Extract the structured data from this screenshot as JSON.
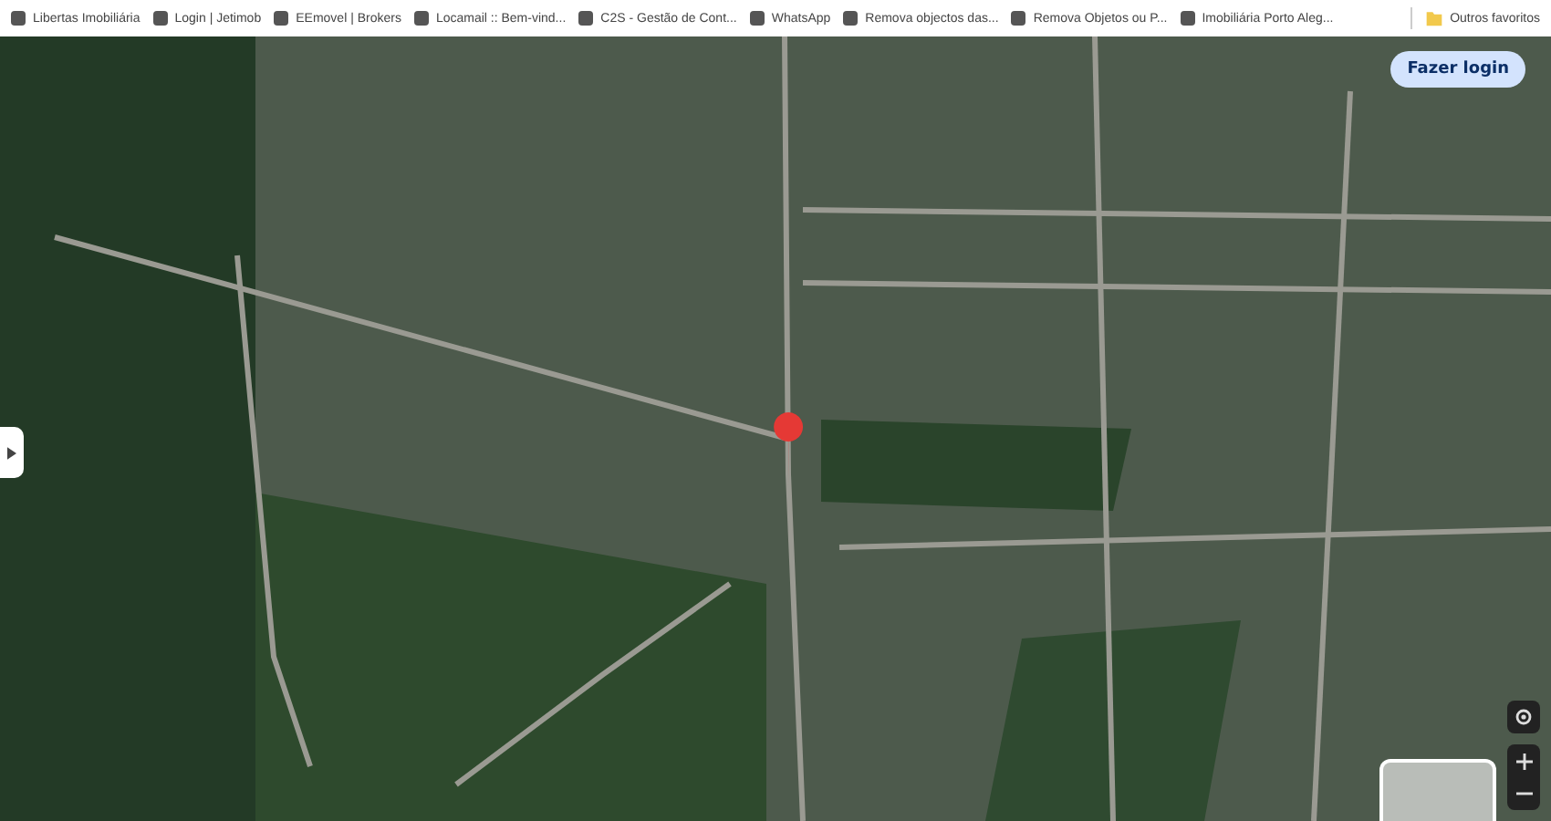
{
  "bookmarks_bar": {
    "items": [
      {
        "label": "Libertas Imobiliária"
      },
      {
        "label": "Login | Jetimob"
      },
      {
        "label": "EEmovel | Brokers"
      },
      {
        "label": "Locamail :: Bem-vind..."
      },
      {
        "label": "C2S - Gestão de Cont..."
      },
      {
        "label": "WhatsApp"
      },
      {
        "label": "Remova objectos das..."
      },
      {
        "label": "Remova Objetos ou P..."
      },
      {
        "label": "Imobiliária Porto Aleg..."
      }
    ],
    "other": {
      "label": "Outros favoritos"
    }
  },
  "map": {
    "login_button": {
      "label": "Fazer login"
    }
  }
}
